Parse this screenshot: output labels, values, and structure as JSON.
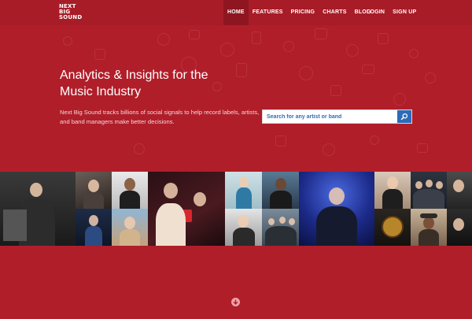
{
  "logo": {
    "lines": [
      "NEXT",
      "BIG",
      "SOUND"
    ]
  },
  "nav": {
    "left": [
      {
        "label": "HOME",
        "active": true
      },
      {
        "label": "FEATURES",
        "active": false
      },
      {
        "label": "PRICING",
        "active": false
      },
      {
        "label": "CHARTS",
        "active": false
      },
      {
        "label": "BLOG",
        "active": false
      }
    ],
    "right": [
      {
        "label": "LOGIN"
      },
      {
        "label": "SIGN UP"
      }
    ]
  },
  "hero": {
    "headline": "Analytics & Insights for the Music Industry",
    "subtext": "Next Big Sound tracks billions of social signals to help record labels, artists, and band managers make better decisions."
  },
  "search": {
    "placeholder": "Search for any artist or band",
    "button_icon": "search-icon"
  },
  "colors": {
    "background": "#b01e2a",
    "header": "#a81c27",
    "active_nav": "#8e1620",
    "search_button": "#2c6bb8",
    "search_text": "#2f6fb6"
  },
  "strip": {
    "icon": "artist-photo"
  },
  "footer": {
    "scroll_icon": "arrow-down-circle-icon"
  }
}
